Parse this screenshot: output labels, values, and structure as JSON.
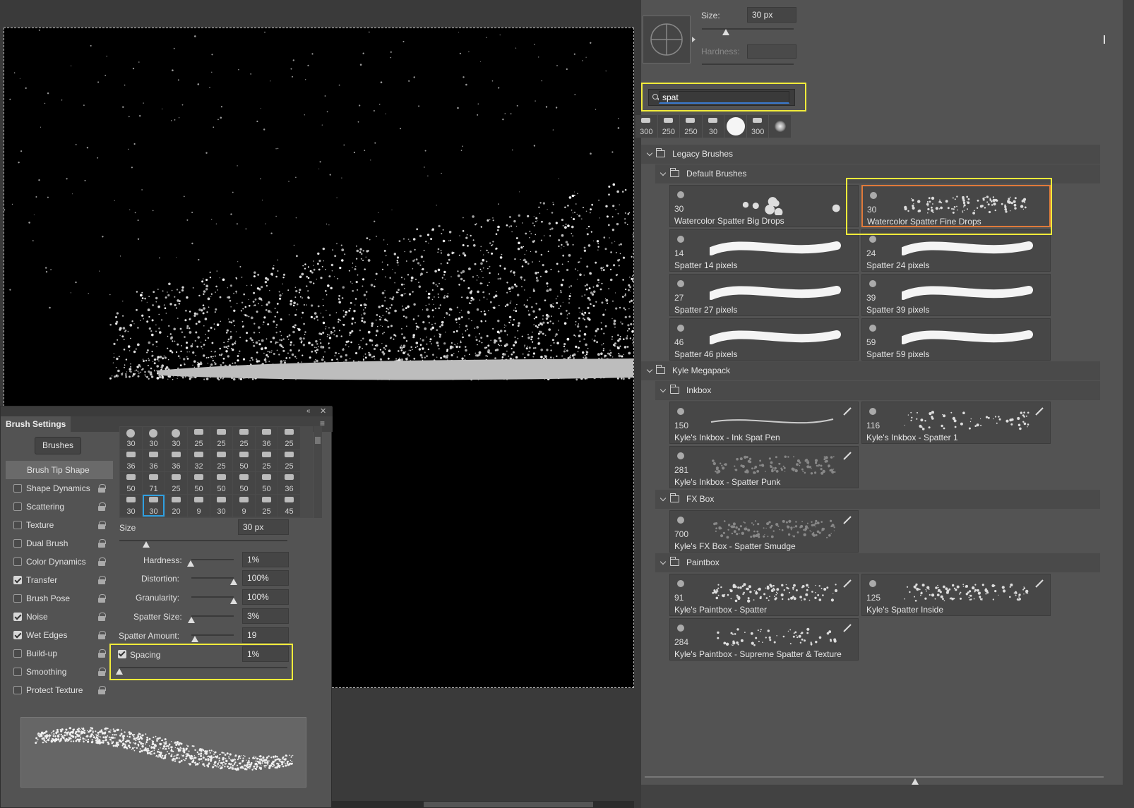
{
  "brush_settings": {
    "title": "Brush Settings",
    "brushes_button": "Brushes",
    "options": [
      {
        "label": "Brush Tip Shape",
        "checked": null,
        "lock": false
      },
      {
        "label": "Shape Dynamics",
        "checked": false,
        "lock": true
      },
      {
        "label": "Scattering",
        "checked": false,
        "lock": true
      },
      {
        "label": "Texture",
        "checked": false,
        "lock": true
      },
      {
        "label": "Dual Brush",
        "checked": false,
        "lock": true
      },
      {
        "label": "Color Dynamics",
        "checked": false,
        "lock": true
      },
      {
        "label": "Transfer",
        "checked": true,
        "lock": true
      },
      {
        "label": "Brush Pose",
        "checked": false,
        "lock": true
      },
      {
        "label": "Noise",
        "checked": true,
        "lock": true
      },
      {
        "label": "Wet Edges",
        "checked": true,
        "lock": true
      },
      {
        "label": "Build-up",
        "checked": false,
        "lock": true
      },
      {
        "label": "Smoothing",
        "checked": false,
        "lock": true
      },
      {
        "label": "Protect Texture",
        "checked": false,
        "lock": true
      }
    ],
    "tip_sizes": [
      "30",
      "30",
      "30",
      "25",
      "25",
      "25",
      "36",
      "25",
      "36",
      "36",
      "36",
      "32",
      "25",
      "50",
      "25",
      "25",
      "50",
      "71",
      "25",
      "50",
      "50",
      "50",
      "50",
      "36",
      "30",
      "30",
      "20",
      "9",
      "30",
      "9",
      "25",
      "45"
    ],
    "selected_tip_index": 25,
    "size_label": "Size",
    "size_value": "30 px",
    "size_fraction": 0.16,
    "hardness_label": "Hardness:",
    "hardness_value": "1%",
    "distortion_label": "Distortion:",
    "distortion_value": "100%",
    "granularity_label": "Granularity:",
    "granularity_value": "100%",
    "spatter_size_label": "Spatter Size:",
    "spatter_size_value": "3%",
    "spatter_amount_label": "Spatter Amount:",
    "spatter_amount_value": "19",
    "spacing_label": "Spacing",
    "spacing_checked": true,
    "spacing_value": "1%"
  },
  "brush_panel": {
    "size_label": "Size:",
    "size_value": "30 px",
    "hardness_label": "Hardness:",
    "search_value": "spat",
    "recent": [
      "300",
      "250",
      "250",
      "30",
      "",
      "300",
      ""
    ],
    "groups": {
      "legacy": "Legacy Brushes",
      "default": "Default Brushes",
      "kyle": "Kyle Megapack",
      "inkbox": "Inkbox",
      "fxbox": "FX Box",
      "paintbox": "Paintbox"
    },
    "default_brushes": [
      {
        "size": "30",
        "name": "Watercolor Spatter Big Drops"
      },
      {
        "size": "30",
        "name": "Watercolor Spatter Fine Drops",
        "selected": true
      },
      {
        "size": "14",
        "name": "Spatter 14 pixels"
      },
      {
        "size": "24",
        "name": "Spatter 24 pixels"
      },
      {
        "size": "27",
        "name": "Spatter 27 pixels"
      },
      {
        "size": "39",
        "name": "Spatter 39 pixels"
      },
      {
        "size": "46",
        "name": "Spatter 46 pixels"
      },
      {
        "size": "59",
        "name": "Spatter 59 pixels"
      }
    ],
    "inkbox_brushes": [
      {
        "size": "150",
        "name": "Kyle's Inkbox - Ink Spat Pen"
      },
      {
        "size": "116",
        "name": "Kyle's Inkbox - Spatter 1"
      },
      {
        "size": "281",
        "name": "Kyle's Inkbox - Spatter Punk"
      }
    ],
    "fxbox_brushes": [
      {
        "size": "700",
        "name": "Kyle's FX Box - Spatter Smudge"
      }
    ],
    "paintbox_brushes": [
      {
        "size": "91",
        "name": "Kyle's Paintbox - Spatter"
      },
      {
        "size": "125",
        "name": "Kyle's Spatter Inside"
      },
      {
        "size": "284",
        "name": "Kyle's Paintbox - Supreme Spatter & Texture"
      }
    ]
  },
  "colors": {
    "highlight": "#f2ec3a",
    "selection": "#e07a3a",
    "accent": "#2e9fe0"
  }
}
